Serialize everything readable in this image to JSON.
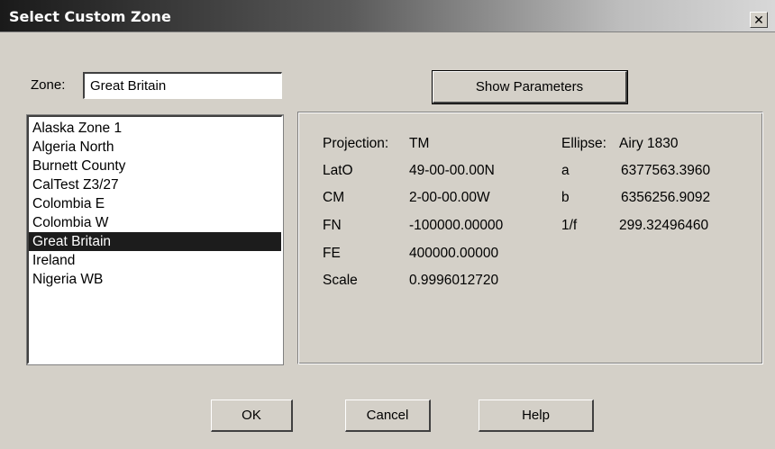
{
  "window": {
    "title": "Select Custom Zone",
    "close_glyph": "✕"
  },
  "zone": {
    "label": "Zone:",
    "value": "Great Britain"
  },
  "show_parameters_label": "Show Parameters",
  "zone_list": {
    "items": [
      "Alaska Zone 1",
      "Algeria North",
      "Burnett County",
      "CalTest Z3/27",
      "Colombia E",
      "Colombia W",
      "Great Britain",
      "Ireland",
      "Nigeria WB"
    ],
    "selected": "Great Britain"
  },
  "parameters": {
    "projection": {
      "label": "Projection:",
      "value": "TM"
    },
    "lat0": {
      "label": "LatO",
      "value": "49-00-00.00N"
    },
    "cm": {
      "label": "CM",
      "value": "2-00-00.00W"
    },
    "fn": {
      "label": "FN",
      "value": "-100000.00000"
    },
    "fe": {
      "label": "FE",
      "value": "400000.00000"
    },
    "scale": {
      "label": "Scale",
      "value": "0.9996012720"
    },
    "ellipse": {
      "label": "Ellipse:",
      "value": "Airy 1830"
    },
    "a": {
      "label": "a",
      "value": "6377563.3960"
    },
    "b": {
      "label": "b",
      "value": "6356256.9092"
    },
    "inv_f": {
      "label": "1/f",
      "value": "299.32496460"
    }
  },
  "buttons": {
    "ok": "OK",
    "cancel": "Cancel",
    "help": "Help"
  }
}
